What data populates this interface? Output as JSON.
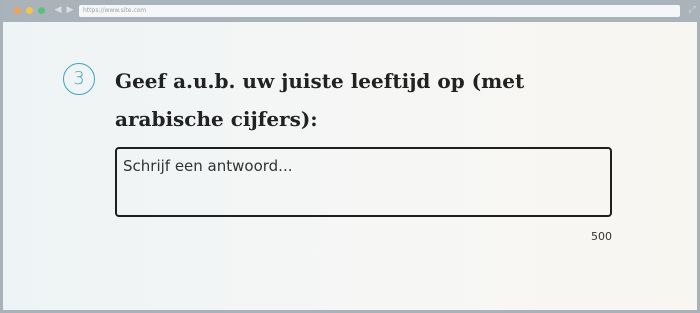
{
  "browser": {
    "url": "https://www.site.com",
    "nav_back": "◀",
    "nav_forward": "▶",
    "expand": "⤢"
  },
  "question": {
    "number": "3",
    "text": "Geef a.u.b. uw juiste leeftijd op (met arabische cijfers):"
  },
  "answer": {
    "placeholder": "Schrijf een antwoord...",
    "value": ""
  },
  "char_limit": "500",
  "colors": {
    "accent": "#3da6c0",
    "chrome": "#aab3ba"
  }
}
